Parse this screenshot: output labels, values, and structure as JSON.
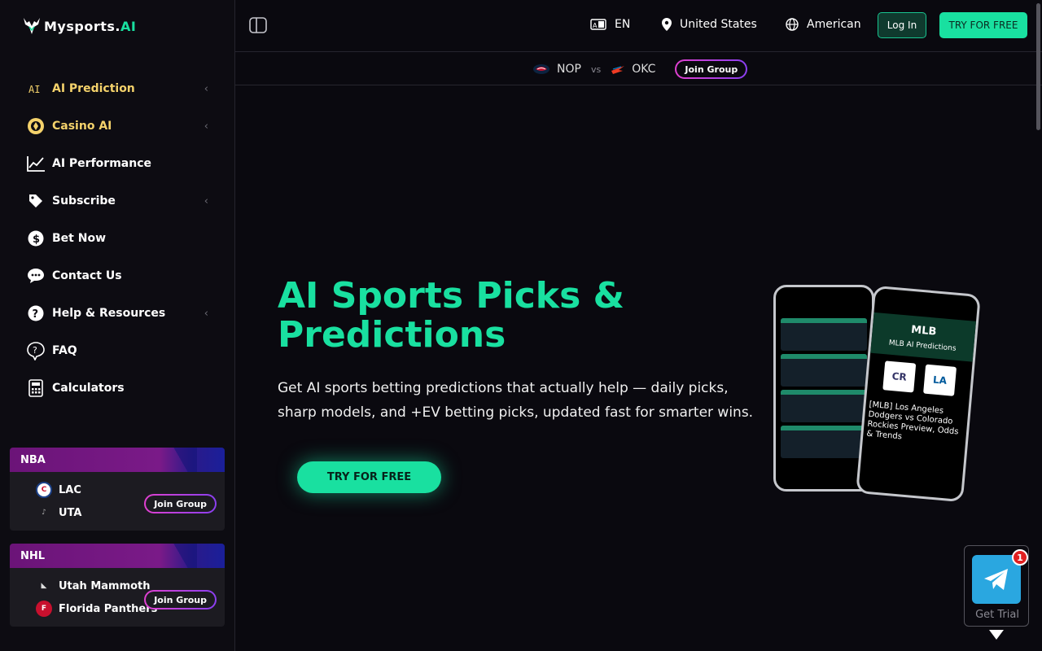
{
  "brand": {
    "name_main": "Mysports.",
    "name_ai": "AI"
  },
  "sidebar": {
    "items": [
      {
        "label": "AI Prediction",
        "icon": "ai-icon",
        "chevron": "‹"
      },
      {
        "label": "Casino AI",
        "icon": "casino-chip-icon",
        "chevron": "‹"
      },
      {
        "label": "AI Performance",
        "icon": "chart-line-icon",
        "chevron": ""
      },
      {
        "label": "Subscribe",
        "icon": "tag-icon",
        "chevron": "‹"
      },
      {
        "label": "Bet Now",
        "icon": "dollar-icon",
        "chevron": ""
      },
      {
        "label": "Contact Us",
        "icon": "chat-icon",
        "chevron": ""
      },
      {
        "label": "Help & Resources",
        "icon": "help-icon",
        "chevron": "‹"
      },
      {
        "label": "FAQ",
        "icon": "faq-icon",
        "chevron": ""
      },
      {
        "label": "Calculators",
        "icon": "calculator-icon",
        "chevron": ""
      }
    ],
    "cards": [
      {
        "league": "NBA",
        "team1": "LAC",
        "team2": "UTA",
        "join": "Join Group"
      },
      {
        "league": "NHL",
        "team1": "Utah Mammoth",
        "team2": "Florida Panthers",
        "join": "Join Group"
      }
    ]
  },
  "header": {
    "language": "EN",
    "region": "United States",
    "odds_format": "American",
    "login": "Log In",
    "try_free": "TRY FOR FREE"
  },
  "matchbar": {
    "home": "NOP",
    "vs": "vs",
    "away": "OKC",
    "join": "Join Group"
  },
  "hero": {
    "title": "AI Sports Picks & Predictions",
    "subtitle": "Get AI sports betting predictions that actually help — daily picks, sharp models, and +EV betting picks, updated fast for smarter wins.",
    "cta": "TRY FOR FREE"
  },
  "phone2": {
    "league": "MLB",
    "heading": "MLB AI Predictions",
    "team1_abbr": "CR",
    "team2_abbr": "LA",
    "headline": "[MLB] Los Angeles Dodgers vs Colorado Rockies Preview, Odds & Trends"
  },
  "telegram": {
    "badge": "1",
    "label": "Get Trial"
  },
  "colors": {
    "accent": "#19e0a0",
    "gold": "#f4d26b",
    "card_purple": "#7a1a88"
  }
}
